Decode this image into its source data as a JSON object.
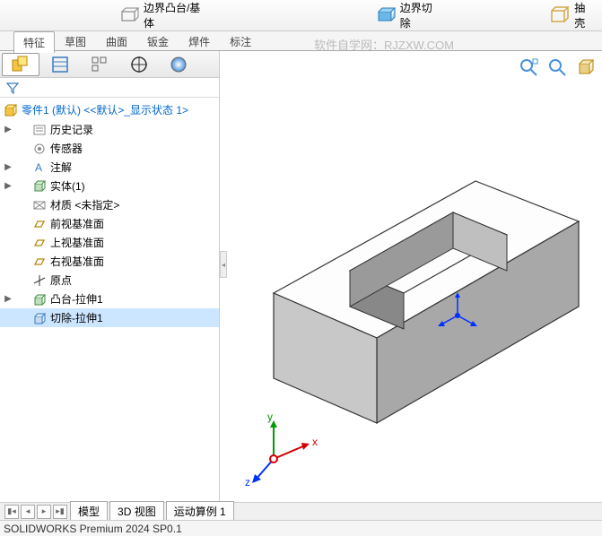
{
  "toolbar": {
    "boss": "边界凸台/基体",
    "cut": "边界切除",
    "shell": "抽壳"
  },
  "tabs": [
    "特征",
    "草图",
    "曲面",
    "钣金",
    "焊件",
    "标注"
  ],
  "watermark": "软件自学网：RJZXW.COM",
  "tree": {
    "title": "零件1 (默认) <<默认>_显示状态 1>",
    "items": [
      {
        "exp": "▶",
        "icon": "history",
        "label": "历史记录"
      },
      {
        "exp": "",
        "icon": "sensor",
        "label": "传感器"
      },
      {
        "exp": "▶",
        "icon": "annot",
        "label": "注解"
      },
      {
        "exp": "▶",
        "icon": "solid",
        "label": "实体(1)"
      },
      {
        "exp": "",
        "icon": "mat",
        "label": "材质 <未指定>"
      },
      {
        "exp": "",
        "icon": "plane",
        "label": "前视基准面"
      },
      {
        "exp": "",
        "icon": "plane",
        "label": "上视基准面"
      },
      {
        "exp": "",
        "icon": "plane",
        "label": "右视基准面"
      },
      {
        "exp": "",
        "icon": "origin",
        "label": "原点"
      },
      {
        "exp": "▶",
        "icon": "extrude",
        "label": "凸台-拉伸1"
      },
      {
        "exp": "",
        "icon": "cut",
        "label": "切除-拉伸1",
        "sel": true
      }
    ]
  },
  "bottomTabs": [
    "模型",
    "3D 视图",
    "运动算例 1"
  ],
  "status": "SOLIDWORKS Premium 2024 SP0.1",
  "axis": {
    "x": "x",
    "y": "y",
    "z": "z"
  }
}
